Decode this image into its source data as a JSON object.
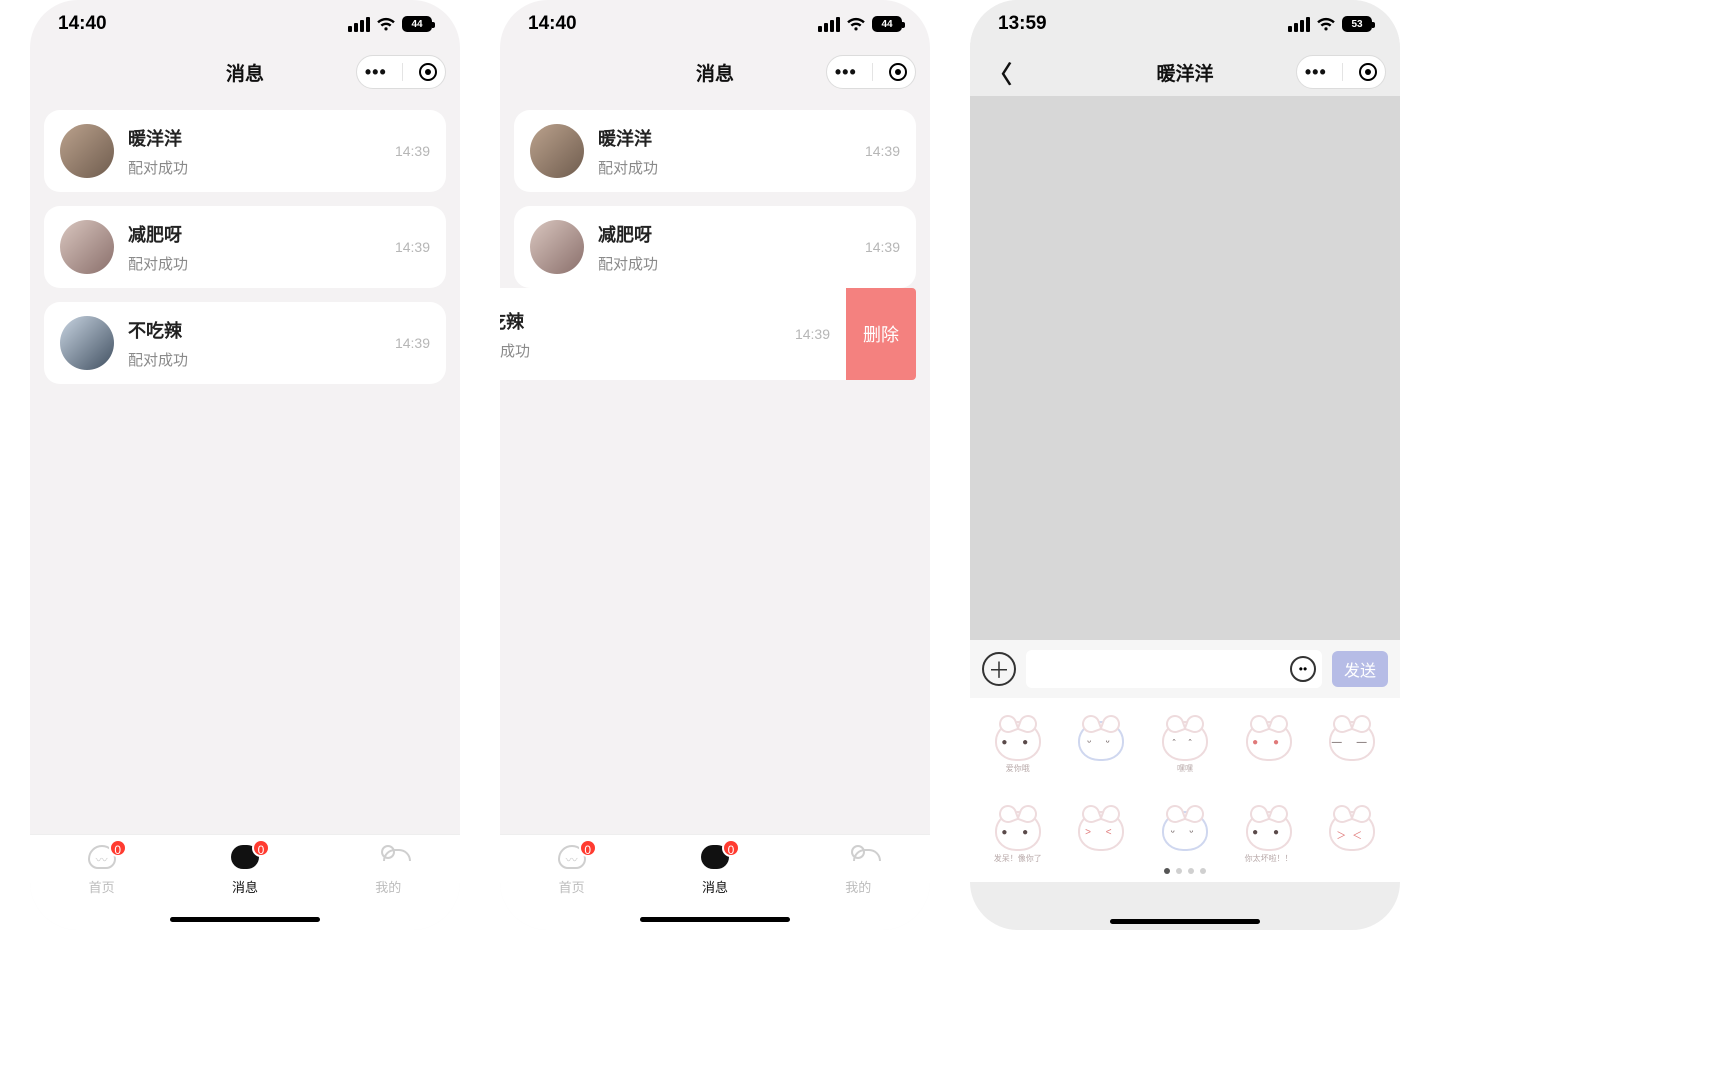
{
  "screens": {
    "list": {
      "status": {
        "time": "14:40",
        "battery": "44"
      },
      "title": "消息",
      "items": [
        {
          "name": "暖洋洋",
          "sub": "配对成功",
          "time": "14:39"
        },
        {
          "name": "减肥呀",
          "sub": "配对成功",
          "time": "14:39"
        },
        {
          "name": "不吃辣",
          "sub": "配对成功",
          "time": "14:39"
        }
      ]
    },
    "swipe": {
      "status": {
        "time": "14:40",
        "battery": "44"
      },
      "title": "消息",
      "delete_label": "删除",
      "items": [
        {
          "name": "暖洋洋",
          "sub": "配对成功",
          "time": "14:39"
        },
        {
          "name": "减肥呀",
          "sub": "配对成功",
          "time": "14:39"
        },
        {
          "name": "不吃辣",
          "sub": "配对成功",
          "time": "14:39"
        }
      ]
    },
    "chat": {
      "status": {
        "time": "13:59",
        "battery": "53"
      },
      "title": "暖洋洋",
      "send_label": "发送",
      "input_placeholder": "",
      "stickers": [
        {
          "caption": "爱你哦"
        },
        {
          "caption": ""
        },
        {
          "caption": "嘿嘿"
        },
        {
          "caption": ""
        },
        {
          "caption": ""
        },
        {
          "caption": "发呆！像你了"
        },
        {
          "caption": ""
        },
        {
          "caption": ""
        },
        {
          "caption": "你太坏啦！！"
        },
        {
          "caption": ""
        }
      ]
    }
  },
  "nav": {
    "items": [
      {
        "label": "首页",
        "badge": "0"
      },
      {
        "label": "消息",
        "badge": "0"
      },
      {
        "label": "我的"
      }
    ]
  }
}
